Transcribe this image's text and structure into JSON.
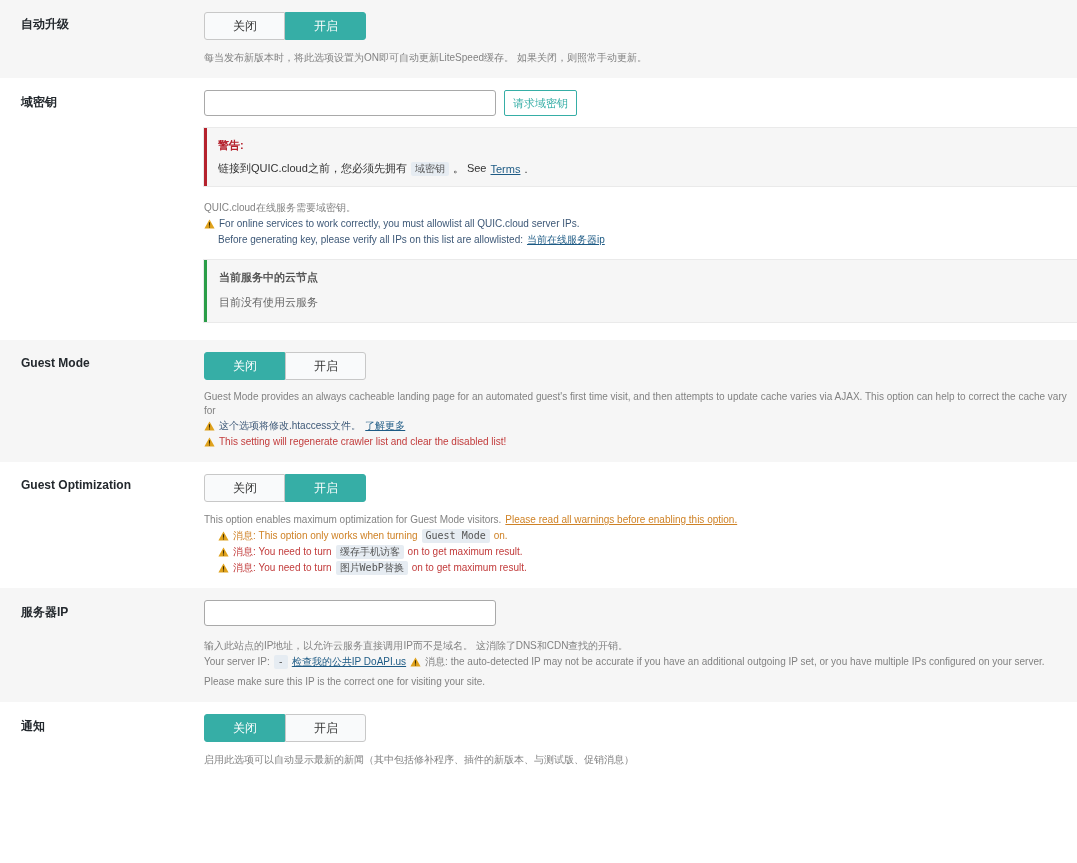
{
  "settings": [
    {
      "label": "自动升级",
      "blocks": [
        {
          "kind": "toggle",
          "options": [
            {
              "label": "关闭",
              "selected": false
            },
            {
              "label": "开启",
              "selected": true
            }
          ]
        },
        {
          "kind": "text",
          "lines": [
            {
              "kind": "muted",
              "parts": [
                {
                  "kind": "text",
                  "text": "每当发布新版本时，将此选项设置为ON即可自动更新LiteSpeed缓存。 如果关闭，则照常手动更新。"
                }
              ]
            }
          ]
        }
      ]
    },
    {
      "label": "域密钥",
      "blocks": [
        {
          "kind": "field",
          "button": "请求域密钥"
        },
        {
          "kind": "notice",
          "title": "警告:",
          "parts": [
            {
              "kind": "text",
              "text": "链接到QUIC.cloud之前，您必须先拥有"
            },
            {
              "kind": "code",
              "text": "域密钥"
            },
            {
              "kind": "text",
              "text": "。 See"
            },
            {
              "kind": "link",
              "text": "Terms"
            },
            {
              "kind": "text",
              "text": "."
            }
          ]
        },
        {
          "kind": "text",
          "lines": [
            {
              "kind": "muted",
              "parts": [
                {
                  "kind": "text",
                  "text": "QUIC.cloud在线服务需要域密钥。"
                }
              ]
            },
            {
              "kind": "info",
              "parts": [
                {
                  "kind": "icon"
                },
                {
                  "kind": "text",
                  "text": "For online services to work correctly, you must allowlist all QUIC.cloud server IPs."
                }
              ]
            },
            {
              "kind": "info",
              "indent": true,
              "parts": [
                {
                  "kind": "text",
                  "text": "Before generating key, please verify all IPs on this list are allowlisted:"
                },
                {
                  "kind": "link",
                  "text": "当前在线服务器ip"
                }
              ]
            }
          ]
        },
        {
          "kind": "node_box",
          "title": "当前服务中的云节点",
          "text": "目前没有使用云服务"
        }
      ]
    },
    {
      "label": "Guest Mode",
      "blocks": [
        {
          "kind": "toggle",
          "options": [
            {
              "label": "关闭",
              "selected": true
            },
            {
              "label": "开启",
              "selected": false
            }
          ]
        },
        {
          "kind": "text",
          "lines": [
            {
              "kind": "muted",
              "parts": [
                {
                  "kind": "text",
                  "text": "Guest Mode provides an always cacheable landing page for an automated guest's first time visit, and then attempts to update cache varies via AJAX. This option can help to correct the cache vary for"
                }
              ]
            },
            {
              "kind": "info",
              "parts": [
                {
                  "kind": "icon"
                },
                {
                  "kind": "text",
                  "text": "这个选项将修改.htaccess文件。"
                },
                {
                  "kind": "link",
                  "text": "了解更多"
                }
              ]
            },
            {
              "kind": "red",
              "parts": [
                {
                  "kind": "icon"
                },
                {
                  "kind": "text",
                  "text": "This setting will regenerate crawler list and clear the disabled list!"
                }
              ]
            }
          ]
        }
      ]
    },
    {
      "label": "Guest Optimization",
      "blocks": [
        {
          "kind": "toggle",
          "options": [
            {
              "label": "关闭",
              "selected": false
            },
            {
              "label": "开启",
              "selected": true
            }
          ]
        },
        {
          "kind": "text",
          "lines": [
            {
              "kind": "muted",
              "parts": [
                {
                  "kind": "text",
                  "text": "This option enables maximum optimization for Guest Mode visitors."
                },
                {
                  "kind": "warnlink",
                  "text": "Please read all warnings before enabling this option."
                }
              ]
            },
            {
              "kind": "orange",
              "indent": true,
              "parts": [
                {
                  "kind": "icon"
                },
                {
                  "kind": "text",
                  "text": "消息: This option only works when turning"
                },
                {
                  "kind": "code",
                  "text": "Guest Mode"
                },
                {
                  "kind": "text",
                  "text": "on."
                }
              ]
            },
            {
              "kind": "red",
              "indent": true,
              "parts": [
                {
                  "kind": "icon"
                },
                {
                  "kind": "text",
                  "text": "消息: You need to turn"
                },
                {
                  "kind": "code",
                  "text": "缓存手机访客"
                },
                {
                  "kind": "text",
                  "text": "on to get maximum result."
                }
              ]
            },
            {
              "kind": "red",
              "indent": true,
              "parts": [
                {
                  "kind": "icon"
                },
                {
                  "kind": "text",
                  "text": "消息: You need to turn"
                },
                {
                  "kind": "code",
                  "text": "图片WebP替换"
                },
                {
                  "kind": "text",
                  "text": "on to get maximum result."
                }
              ]
            }
          ]
        }
      ]
    },
    {
      "label": "服务器IP",
      "blocks": [
        {
          "kind": "field"
        },
        {
          "kind": "text",
          "lines": [
            {
              "kind": "muted",
              "parts": [
                {
                  "kind": "text",
                  "text": "输入此站点的IP地址，以允许云服务直接调用IP而不是域名。 这消除了DNS和CDN查找的开销。"
                }
              ]
            },
            {
              "kind": "muted",
              "parts": [
                {
                  "kind": "text",
                  "text": "Your server IP:"
                },
                {
                  "kind": "code",
                  "text": "-"
                },
                {
                  "kind": "link",
                  "text": "检查我的公共IP DoAPI.us"
                },
                {
                  "kind": "icon"
                },
                {
                  "kind": "text",
                  "text": "消息: the auto-detected IP may not be accurate if you have an additional outgoing IP set, or you have multiple IPs configured on your server."
                }
              ]
            }
          ]
        },
        {
          "kind": "text",
          "lines": [
            {
              "kind": "muted",
              "parts": [
                {
                  "kind": "text",
                  "text": "Please make sure this IP is the correct one for visiting your site."
                }
              ]
            }
          ]
        }
      ]
    },
    {
      "label": "通知",
      "blocks": [
        {
          "kind": "toggle",
          "options": [
            {
              "label": "关闭",
              "selected": true
            },
            {
              "label": "开启",
              "selected": false
            }
          ]
        },
        {
          "kind": "text",
          "lines": [
            {
              "kind": "muted",
              "parts": [
                {
                  "kind": "text",
                  "text": "启用此选项可以自动显示最新的新闻（其中包括修补程序、插件的新版本、与测试版、促销消息）"
                }
              ]
            }
          ]
        }
      ]
    }
  ]
}
